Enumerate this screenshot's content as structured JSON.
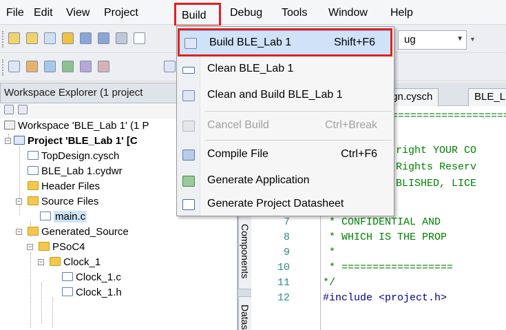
{
  "menubar": {
    "file": "File",
    "edit": "Edit",
    "view": "View",
    "project": "Project",
    "build": "Build",
    "debug": "Debug",
    "tools": "Tools",
    "window": "Window",
    "help": "Help"
  },
  "toolbar": {
    "config_value": "Debug",
    "config_value_visible": "ug"
  },
  "workspace": {
    "header": "Workspace Explorer (1 project",
    "tree": [
      {
        "label": "Workspace 'BLE_Lab 1' (1 P",
        "icon": "workspace-icon"
      },
      {
        "label": "Project  'BLE_Lab 1' [C",
        "icon": "project-icon"
      },
      {
        "label": "TopDesign.cysch",
        "icon": "schematic-icon"
      },
      {
        "label": "BLE_Lab 1.cydwr",
        "icon": "design-wide-resources-icon"
      },
      {
        "label": "Header Files",
        "icon": "folder-icon"
      },
      {
        "label": "Source Files",
        "icon": "folder-icon"
      },
      {
        "label": "main.c",
        "icon": "c-file-icon"
      },
      {
        "label": "Generated_Source",
        "icon": "folder-icon"
      },
      {
        "label": "PSoC4",
        "icon": "folder-icon"
      },
      {
        "label": "Clock_1",
        "icon": "folder-icon"
      },
      {
        "label": "Clock_1.c",
        "icon": "c-file-icon"
      },
      {
        "label": "Clock_1.h",
        "icon": "h-file-icon"
      }
    ]
  },
  "side_tabs": {
    "components": "Components",
    "datasheet": "Datas"
  },
  "editor": {
    "tabs": [
      "esign.cysch",
      "BLE_L"
    ],
    "line_numbers": [
      "7",
      "8",
      "9",
      "10",
      "11",
      "12"
    ],
    "lines_partial_top": [
      "============================",
      "right YOUR CO",
      "Rights Reserv",
      "BLISHED, LICE"
    ],
    "lines": [
      " * CONFIDENTIAL AND",
      " * WHICH IS THE PROP",
      " *",
      " * ==================",
      "*/",
      "#include <project.h>"
    ]
  },
  "build_menu": {
    "items": [
      {
        "label": "Build BLE_Lab 1",
        "shortcut": "Shift+F6",
        "enabled": true,
        "icon": "build-icon"
      },
      {
        "label": "Clean BLE_Lab 1",
        "shortcut": "",
        "enabled": true,
        "icon": "clean-icon"
      },
      {
        "label": "Clean and Build BLE_Lab 1",
        "shortcut": "",
        "enabled": true,
        "icon": "clean-build-icon"
      },
      {
        "label": "Cancel Build",
        "shortcut": "Ctrl+Break",
        "enabled": false,
        "icon": "cancel-build-icon"
      },
      {
        "label": "Compile File",
        "shortcut": "Ctrl+F6",
        "enabled": true,
        "icon": "compile-icon"
      },
      {
        "label": "Generate Application",
        "shortcut": "",
        "enabled": true,
        "icon": "generate-app-icon"
      },
      {
        "label": "Generate Project Datasheet",
        "shortcut": "",
        "enabled": true,
        "icon": "datasheet-icon"
      }
    ]
  },
  "colors": {
    "highlight_border": "#e02020",
    "menu_selected": "#cfe2f8",
    "code_comment": "#008000",
    "line_number": "#2c8a8a"
  }
}
